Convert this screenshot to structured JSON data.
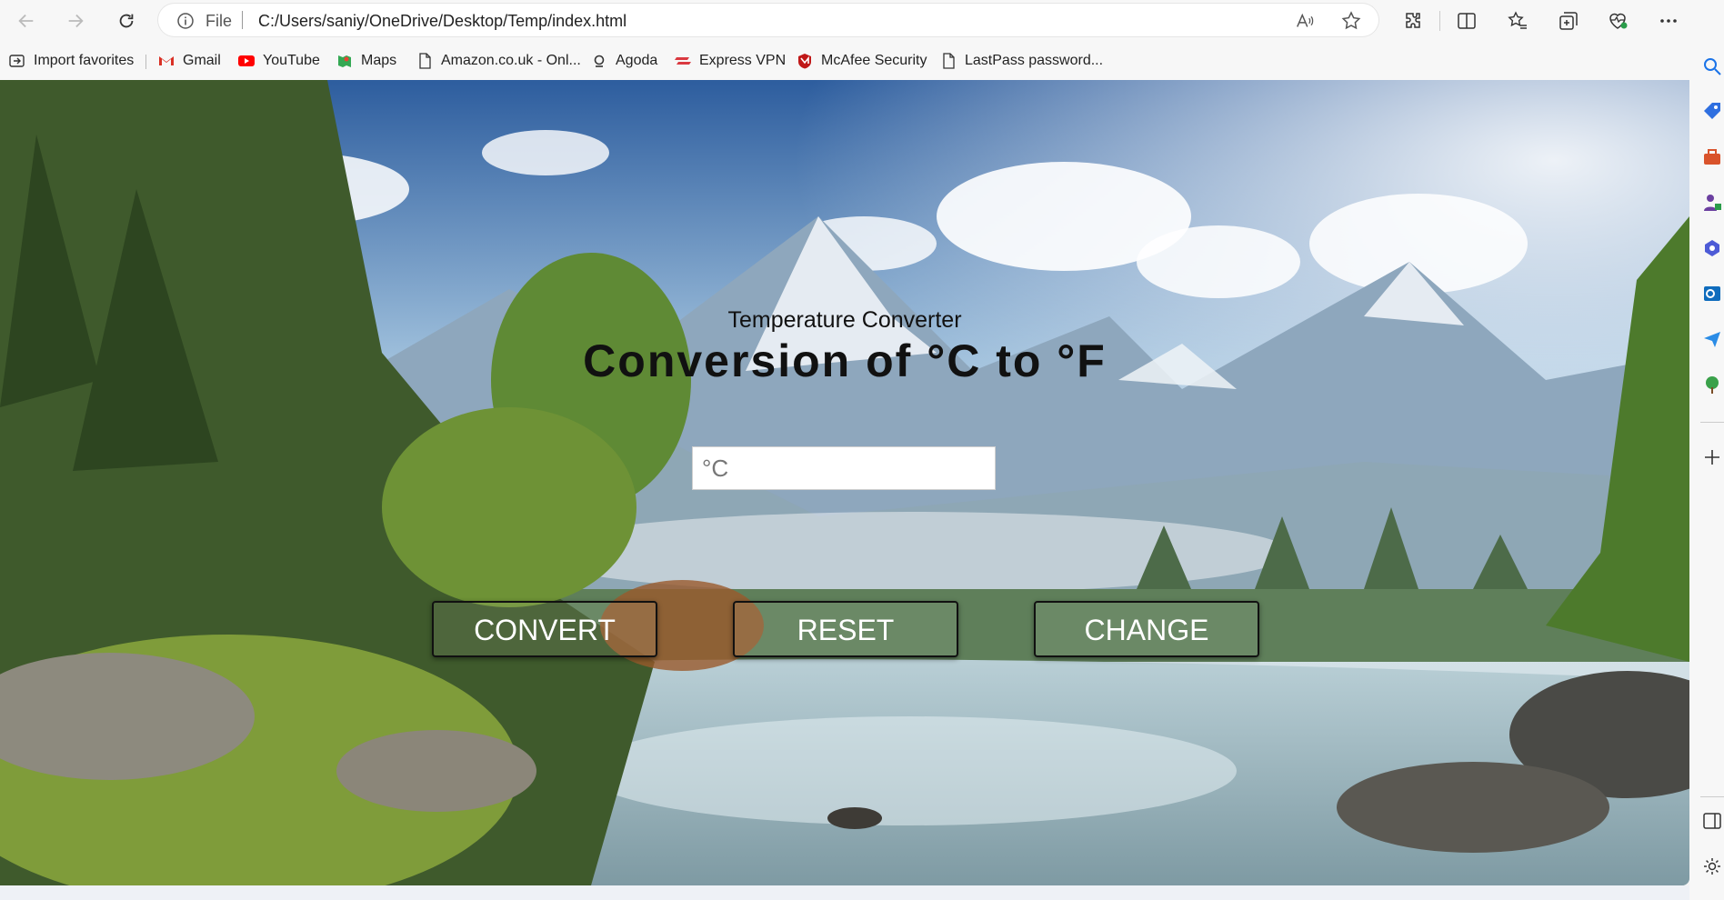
{
  "browser": {
    "address": {
      "scheme_label": "File",
      "url": "C:/Users/saniy/OneDrive/Desktop/Temp/index.html"
    },
    "favorites": [
      {
        "label": "Import favorites",
        "icon": "import-icon"
      },
      {
        "label": "Gmail",
        "icon": "gmail-icon"
      },
      {
        "label": "YouTube",
        "icon": "youtube-icon"
      },
      {
        "label": "Maps",
        "icon": "maps-icon"
      },
      {
        "label": "Amazon.co.uk - Onl...",
        "icon": "page-icon"
      },
      {
        "label": "Agoda",
        "icon": "agoda-icon"
      },
      {
        "label": "Express VPN",
        "icon": "expressvpn-icon"
      },
      {
        "label": "McAfee Security",
        "icon": "mcafee-icon"
      },
      {
        "label": "LastPass password...",
        "icon": "page-icon"
      }
    ]
  },
  "page": {
    "subtitle": "Temperature Converter",
    "title": "Conversion of °C to °F",
    "input": {
      "placeholder": "°C",
      "value": ""
    },
    "buttons": {
      "convert": "CONVERT",
      "reset": "RESET",
      "change": "CHANGE"
    }
  },
  "colors": {
    "button_text": "#ffffff",
    "button_border": "#111111",
    "title_text": "#111111"
  }
}
